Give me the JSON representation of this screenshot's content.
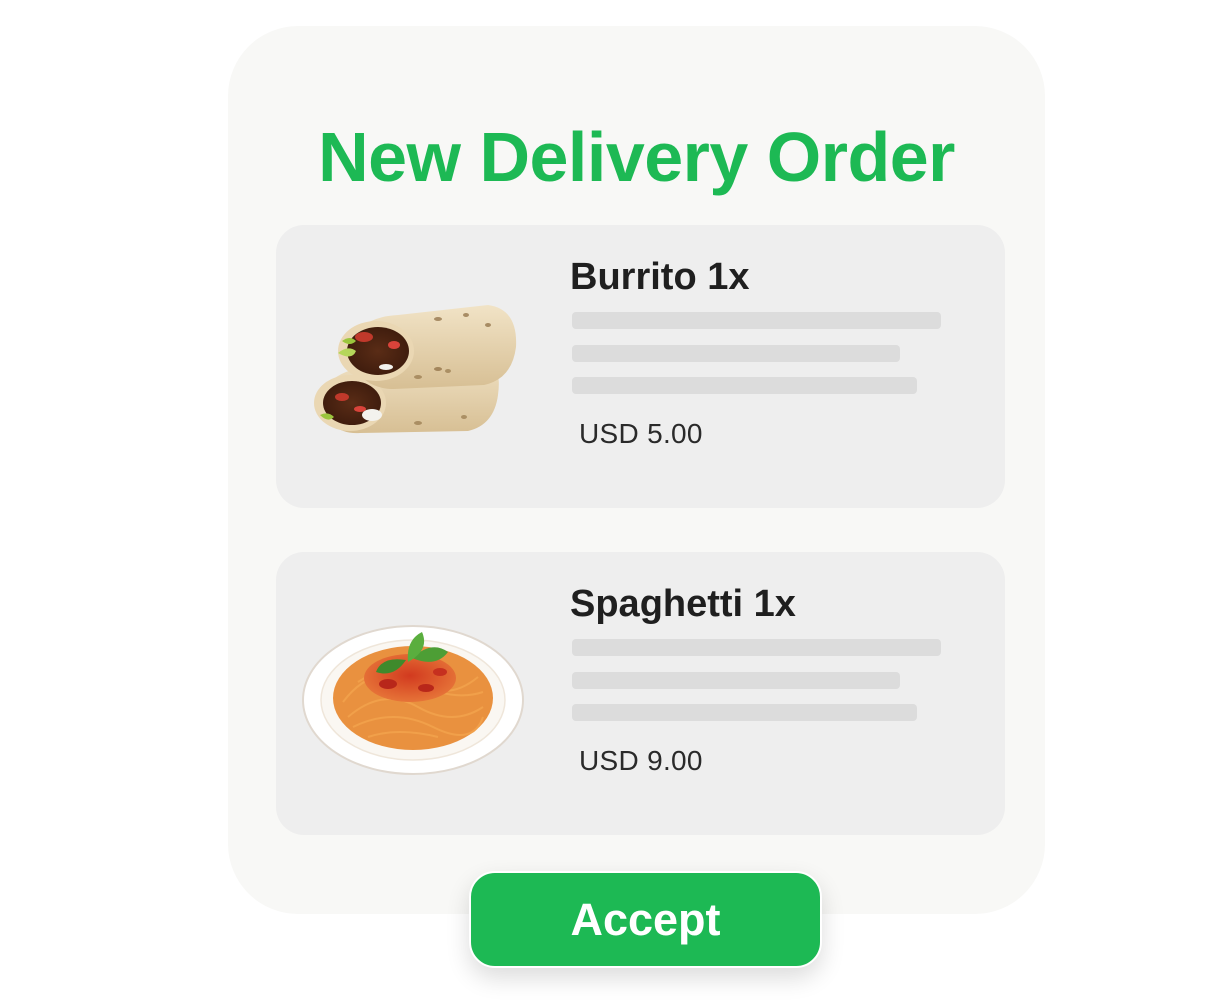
{
  "theme": {
    "accent": "#1db954",
    "card_background": "#f8f8f6",
    "item_background": "#eeeeee",
    "skeleton_color": "#dcdcdc"
  },
  "order": {
    "title": "New Delivery Order",
    "items": [
      {
        "name": "Burrito 1x",
        "price": "USD 5.00",
        "image": "burrito-image"
      },
      {
        "name": "Spaghetti 1x",
        "price": "USD 9.00",
        "image": "spaghetti-image"
      }
    ],
    "accept_label": "Accept"
  }
}
